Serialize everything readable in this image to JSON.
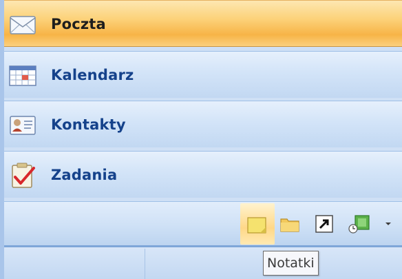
{
  "navigation": {
    "items": [
      {
        "label": "Poczta",
        "selected": true,
        "icon": "mail-envelope-icon"
      },
      {
        "label": "Kalendarz",
        "selected": false,
        "icon": "calendar-icon"
      },
      {
        "label": "Kontakty",
        "selected": false,
        "icon": "contact-card-icon"
      },
      {
        "label": "Zadania",
        "selected": false,
        "icon": "task-checkmark-icon"
      }
    ]
  },
  "toolbar": {
    "buttons": [
      {
        "icon": "notes-icon",
        "hovered": true
      },
      {
        "icon": "folder-icon"
      },
      {
        "icon": "shortcut-arrow-icon"
      },
      {
        "icon": "journal-icon"
      },
      {
        "icon": "chevron-down-icon"
      }
    ]
  },
  "tooltip": {
    "text": "Notatki"
  },
  "colors": {
    "selected_gradient_mid": "#f7b447",
    "nav_text": "#15428b",
    "pane_background": "#cfe0f5"
  }
}
